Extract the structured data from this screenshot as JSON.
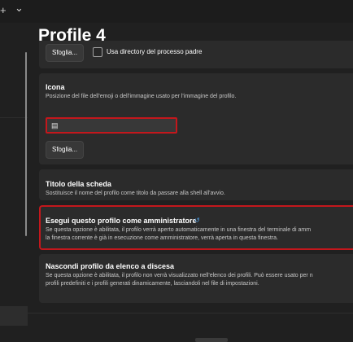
{
  "titlebar": {
    "add_glyph": "+",
    "dropdown_glyph": "⌄"
  },
  "page": {
    "title": "Profile 4"
  },
  "directory_card": {
    "browse_label": "Sfoglia...",
    "checkbox_label": "Usa directory del processo padre",
    "checked": false
  },
  "icon_card": {
    "title": "Icona",
    "description": "Posizione del file dell'emoji o dell'immagine usato per l'immagine del profilo.",
    "input_value": "",
    "input_glyph": "▤",
    "browse_label": "Sfoglia..."
  },
  "tab_title_card": {
    "title": "Titolo della scheda",
    "description": "Sostituisce il nome del profilo come titolo da passare alla shell all'avvio."
  },
  "admin_card": {
    "title": "Esegui questo profilo come amministratore",
    "reset_glyph": "↺",
    "description_line1": "Se questa opzione è abilitata, il profilo verrà aperto automaticamente in una finestra del terminale di amm",
    "description_line2": "la finestra corrente è già in esecuzione come amministratore, verrà aperta in questa finestra."
  },
  "hide_card": {
    "title": "Nascondi profilo da elenco a discesa",
    "description_line1": "Se questa opzione è abilitata, il profilo non verrà visualizzato nell'elenco dei profili. Può essere usato per n",
    "description_line2": "profili predefiniti e i profili generati dinamicamente, lasciandoli nel file di impostazioni."
  },
  "colors": {
    "accent": "#4ea3f0",
    "highlight": "#c4171c",
    "card": "#2b2b2b",
    "background": "#202020"
  }
}
